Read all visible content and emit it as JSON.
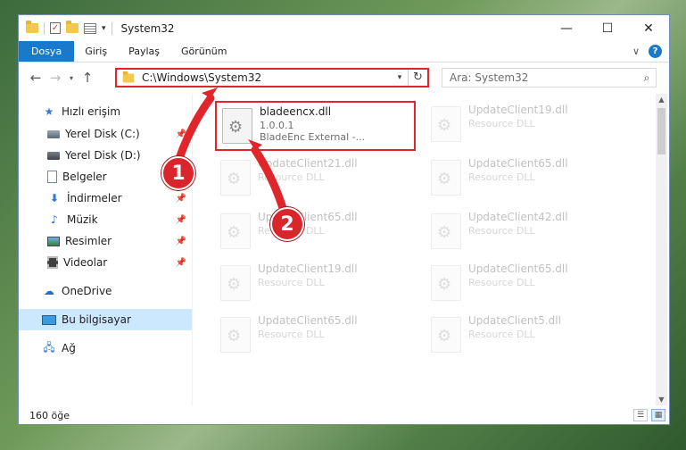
{
  "window": {
    "title": "System32",
    "controls": {
      "minimize": "—",
      "maximize": "☐",
      "close": "✕"
    }
  },
  "ribbon": {
    "tabs": [
      "Dosya",
      "Giriş",
      "Paylaş",
      "Görünüm"
    ],
    "help": "?"
  },
  "address": {
    "path": "C:\\Windows\\System32",
    "search_placeholder": "Ara: System32"
  },
  "sidebar": {
    "items": [
      {
        "label": "Hızlı erişim",
        "icon": "star-icon"
      },
      {
        "label": "Yerel Disk (C:)",
        "icon": "drive-icon",
        "pinned": true
      },
      {
        "label": "Yerel Disk (D:)",
        "icon": "drive-icon"
      },
      {
        "label": "Belgeler",
        "icon": "documents-icon",
        "pinned": true
      },
      {
        "label": "İndirmeler",
        "icon": "download-icon",
        "pinned": true
      },
      {
        "label": "Müzik",
        "icon": "music-icon",
        "pinned": true
      },
      {
        "label": "Resimler",
        "icon": "pictures-icon",
        "pinned": true
      },
      {
        "label": "Videolar",
        "icon": "videos-icon",
        "pinned": true
      },
      {
        "label": "OneDrive",
        "icon": "cloud-icon"
      },
      {
        "label": "Bu bilgisayar",
        "icon": "computer-icon",
        "selected": true
      },
      {
        "label": "Ağ",
        "icon": "network-icon"
      }
    ]
  },
  "files": [
    {
      "name": "bladeencx.dll",
      "line1": "1.0.0.1",
      "line2": "BladeEnc External -...",
      "highlighted": true
    },
    {
      "name": "UpdateClient19.dll",
      "line1": "Resource DLL"
    },
    {
      "name": "UpdateClient21.dll",
      "line1": "Resource DLL"
    },
    {
      "name": "UpdateClient65.dll",
      "line1": "Resource DLL"
    },
    {
      "name": "UpdateClient65.dll",
      "line1": "Resource DLL"
    },
    {
      "name": "UpdateClient42.dll",
      "line1": "Resource DLL"
    },
    {
      "name": "UpdateClient19.dll",
      "line1": "Resource DLL"
    },
    {
      "name": "UpdateClient65.dll",
      "line1": "Resource DLL"
    },
    {
      "name": "UpdateClient65.dll",
      "line1": "Resource DLL"
    },
    {
      "name": "UpdateClient5.dll",
      "line1": "Resource DLL"
    }
  ],
  "status": {
    "count": "160 öğe"
  },
  "annotations": {
    "step1": "1",
    "step2": "2",
    "color": "#e0252b"
  }
}
